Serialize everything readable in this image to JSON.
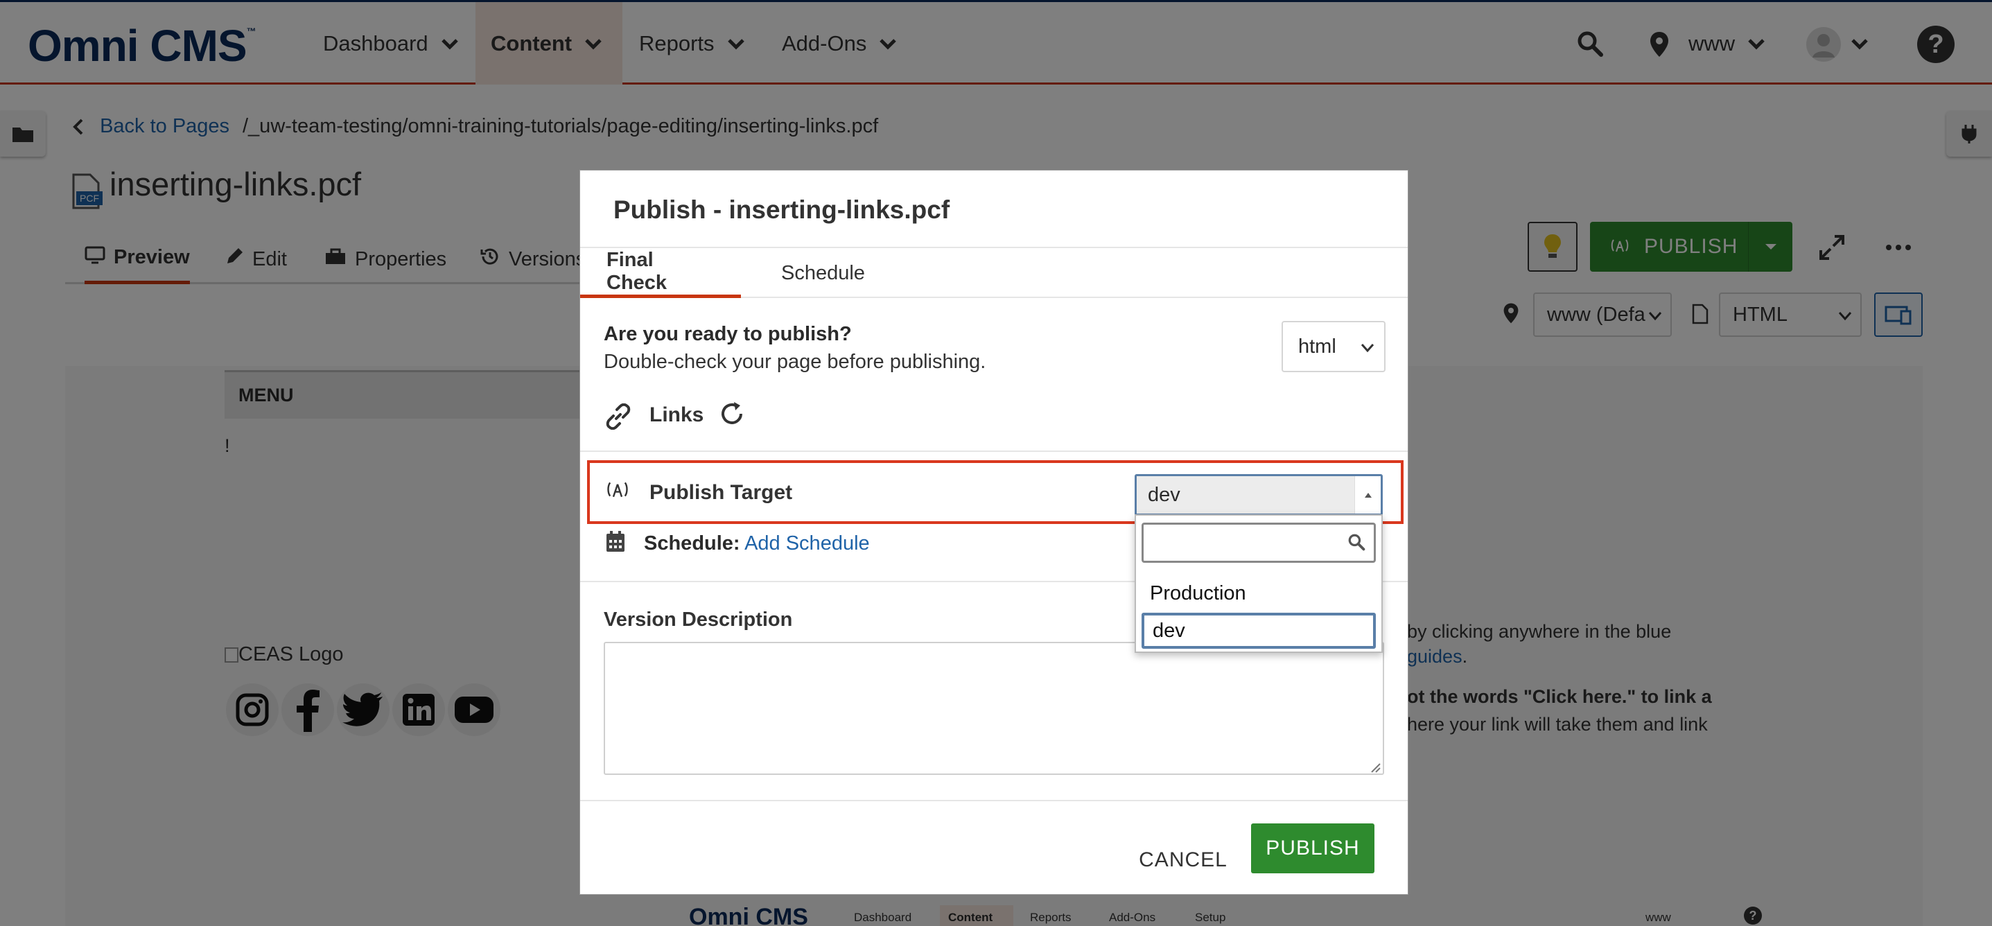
{
  "app": {
    "name": "Omni CMS",
    "logo_mark": "™"
  },
  "nav": {
    "items": [
      {
        "label": "Dashboard"
      },
      {
        "label": "Content"
      },
      {
        "label": "Reports"
      },
      {
        "label": "Add-Ons"
      }
    ],
    "site": "www"
  },
  "breadcrumb": {
    "back": "Back to Pages",
    "path": "/_uw-team-testing/omni-training-tutorials/page-editing/inserting-links.pcf"
  },
  "file": {
    "title": "inserting-links.pcf",
    "badge": "PCF"
  },
  "page_tabs": [
    {
      "label": "Preview"
    },
    {
      "label": "Edit"
    },
    {
      "label": "Properties"
    },
    {
      "label": "Versions"
    }
  ],
  "toolbar": {
    "publish": "PUBLISH",
    "site_select": "www (Defa",
    "output_select": "HTML"
  },
  "preview": {
    "menu": "MENU",
    "bang": "!",
    "logo_alt": "CEAS Logo",
    "text1": "by clicking anywhere in the blue",
    "text2": "guides",
    "text2_end": ".",
    "text3": "ot the words \"Click here.\" to link a",
    "text4": "here your link will take them and link"
  },
  "mini": {
    "logo": "Omni CMS",
    "items": [
      "Dashboard",
      "Content",
      "Reports",
      "Add-Ons",
      "Setup"
    ],
    "site": "www"
  },
  "modal": {
    "title": "Publish - inserting-links.pcf",
    "tabs": [
      "Final Check",
      "Schedule"
    ],
    "question": "Are you ready to publish?",
    "subtext": "Double-check your page before publishing.",
    "format": "html",
    "links_label": "Links",
    "target_label": "Publish Target",
    "target_value": "dev",
    "schedule_label": "Schedule:",
    "schedule_link": "Add Schedule",
    "version_label": "Version Description",
    "version_value": "",
    "dropdown_options": [
      "Production",
      "dev"
    ],
    "cancel": "CANCEL",
    "publish": "PUBLISH"
  },
  "colors": {
    "brand": "#0a2a5a",
    "accent": "#c8360f",
    "publish": "#2e8b2e",
    "link": "#1f63a8"
  }
}
